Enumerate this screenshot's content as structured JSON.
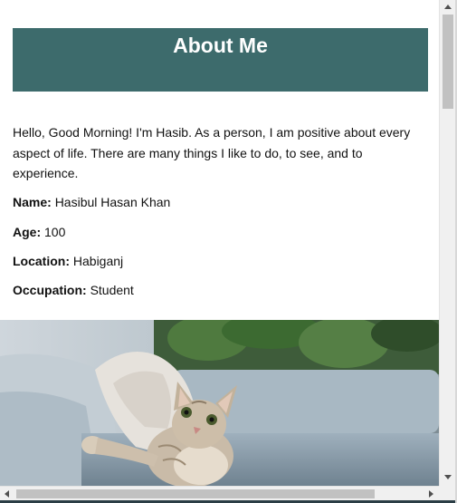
{
  "header": {
    "title": "About Me",
    "background_color": "#3d6b6c"
  },
  "intro": {
    "text": "Hello, Good Morning! I'm Hasib. As a person, I am positive about every aspect of life. There are many things I like to do, to see, and to experience."
  },
  "details": [
    {
      "label": "Name:",
      "value": "Hasibul Hasan Khan"
    },
    {
      "label": "Age:",
      "value": "100"
    },
    {
      "label": "Location:",
      "value": "Habiganj"
    },
    {
      "label": "Occupation:",
      "value": "Student"
    }
  ],
  "photo": {
    "icon": "kitten-on-sofa-image"
  }
}
